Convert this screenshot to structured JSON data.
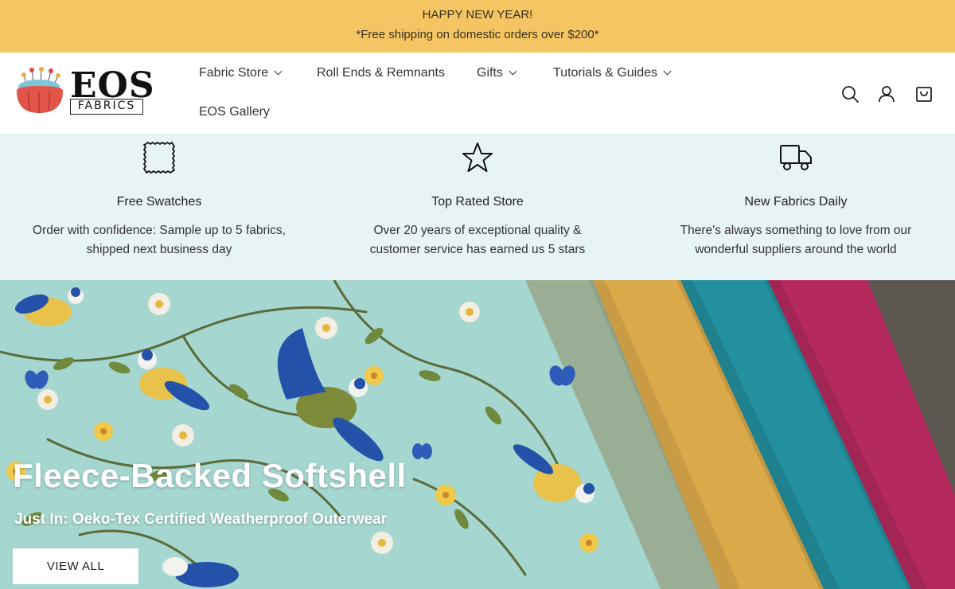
{
  "announcement": {
    "line1": "HAPPY NEW YEAR!",
    "line2": "*Free shipping on domestic orders over $200*"
  },
  "logo": {
    "word": "EOS",
    "sub": "FABRICS"
  },
  "nav": {
    "items": [
      {
        "label": "Fabric Store",
        "dropdown": true
      },
      {
        "label": "Roll Ends & Remnants",
        "dropdown": false
      },
      {
        "label": "Gifts",
        "dropdown": true
      },
      {
        "label": "Tutorials & Guides",
        "dropdown": true
      },
      {
        "label": "EOS Gallery",
        "dropdown": false
      }
    ],
    "icons": [
      "search-icon",
      "account-icon",
      "cart-icon"
    ]
  },
  "features": [
    {
      "icon": "swatch-icon",
      "title": "Free Swatches",
      "text": "Order with confidence: Sample up to 5 fabrics, shipped next business day"
    },
    {
      "icon": "star-icon",
      "title": "Top Rated Store",
      "text": "Over 20 years of exceptional quality & customer service has earned us 5 stars"
    },
    {
      "icon": "truck-icon",
      "title": "New Fabrics Daily",
      "text": "There's always something to love from our wonderful suppliers around the world"
    }
  ],
  "hero": {
    "title": "Fleece-Backed Softshell",
    "subtitle": "Just In: Oeko-Tex Certified Weatherproof Outerwear",
    "button": "VIEW ALL"
  },
  "colors": {
    "announcement_bg": "#f5c563",
    "features_bg": "#e8f3f6",
    "fabric_mint": "#a5d6cf",
    "fabric_sage": "#9aae95",
    "fabric_mustard": "#d9a94a",
    "fabric_teal": "#23909f",
    "fabric_magenta": "#b52a5e",
    "fabric_charcoal": "#5b5650"
  }
}
